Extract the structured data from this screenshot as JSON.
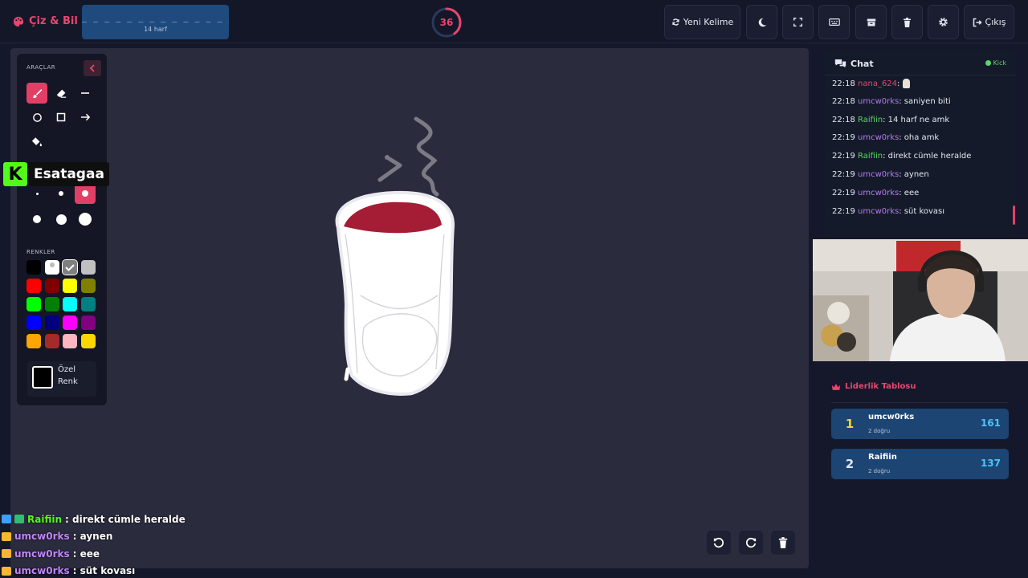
{
  "app": {
    "name": "Çiz & Bil",
    "brand_color": "#e8466f"
  },
  "word": {
    "mask": "_ _ _ _ _ _ _ _ _ _ _ _ _ _",
    "hint": "14 harf"
  },
  "timer": {
    "value": "36",
    "progress": 0.4
  },
  "toolbar": {
    "new_word_label": "Yeni Kelime",
    "logout_label": "Çıkış",
    "icons": [
      "refresh-icon",
      "moon-icon",
      "fullscreen-icon",
      "keyboard-icon",
      "archive-icon",
      "trash-icon",
      "gear-icon",
      "logout-icon"
    ]
  },
  "tools": {
    "title": "ARAÇLAR",
    "items": [
      "brush",
      "eraser",
      "line",
      "circle",
      "rectangle",
      "arrow",
      "fill"
    ],
    "active_tool": "brush",
    "active_size": 3,
    "colors_title": "RENKLER",
    "colors": [
      "#000000",
      "#ffffff",
      "#7f7f7f",
      "#c0c0c0",
      "#ff0000",
      "#800000",
      "#ffff00",
      "#808000",
      "#00ff00",
      "#008000",
      "#00ffff",
      "#008080",
      "#0000ff",
      "#000080",
      "#ff00ff",
      "#800080",
      "#ffa500",
      "#a52a2a",
      "#ffb6c1",
      "#ffd700"
    ],
    "selected_color": "#7f7f7f",
    "custom_line1": "Özel",
    "custom_line2": "Renk"
  },
  "overlay": {
    "streamer": "Esatagaa"
  },
  "stream_chat": [
    {
      "user": "Raifiin",
      "text": ": direkt cümle heralde",
      "color": "#53fc18"
    },
    {
      "user": "umcw0rks",
      "text": ": aynen",
      "color": "#c084fc"
    },
    {
      "user": "umcw0rks",
      "text": ": eee",
      "color": "#c084fc"
    },
    {
      "user": "umcw0rks",
      "text": ": süt kovası",
      "color": "#c084fc"
    }
  ],
  "chat": {
    "title": "Chat",
    "status": "Kick",
    "messages": [
      {
        "time": "22:18",
        "user": "nana_624",
        "text": ":",
        "color": "#e8466f"
      },
      {
        "time": "22:18",
        "user": "umcw0rks",
        "text": ": saniyen biti",
        "color": "#b07cf0"
      },
      {
        "time": "22:18",
        "user": "Raifiin",
        "text": ": 14 harf ne amk",
        "color": "#5bd46a"
      },
      {
        "time": "22:19",
        "user": "umcw0rks",
        "text": ": oha amk",
        "color": "#b07cf0"
      },
      {
        "time": "22:19",
        "user": "Raifiin",
        "text": ": direkt cümle heralde",
        "color": "#5bd46a"
      },
      {
        "time": "22:19",
        "user": "umcw0rks",
        "text": ": aynen",
        "color": "#b07cf0"
      },
      {
        "time": "22:19",
        "user": "umcw0rks",
        "text": ": eee",
        "color": "#b07cf0"
      },
      {
        "time": "22:19",
        "user": "umcw0rks",
        "text": ": süt kovası",
        "color": "#b07cf0"
      }
    ]
  },
  "leaderboard": {
    "title": "Liderlik Tablosu",
    "rows": [
      {
        "rank": "1",
        "name": "umcw0rks",
        "sub": "2 doğru",
        "score": "161",
        "rank_color": "#f5d33b"
      },
      {
        "rank": "2",
        "name": "Raifiin",
        "sub": "2 doğru",
        "score": "137",
        "rank_color": "#dfe6f5"
      }
    ]
  }
}
